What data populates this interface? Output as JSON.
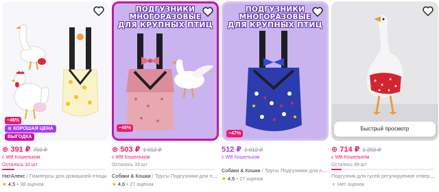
{
  "colors": {
    "accent": "#cb11ab",
    "price": "#f01b6b",
    "promo": "#a73afd",
    "star": "#ff9d00"
  },
  "icons": {
    "favorite": "heart-outline-icon",
    "rating": "star-icon"
  },
  "products": [
    {
      "price": "391 ₽",
      "old_price": "750 ₽",
      "wallet": "с WB Кошельком",
      "stock": "Осталось 10 шт",
      "stock_fraction": 0.12,
      "brand": "НатАлекс",
      "name": " / Памперсы для домашней птицы",
      "rating": "4,5",
      "reviews": "38 оценок",
      "discount": "−46%",
      "good_price": "ХОРОШАЯ ЦЕНА",
      "benefit": "ВЫГОДКА"
    },
    {
      "price": "503 ₽",
      "old_price": "1 012 ₽",
      "wallet": "с WB Кошельком",
      "stock": "Осталось 33 шт",
      "stock_fraction": 0.0,
      "brand": "Собаки & Кошки",
      "name": " / Трусы Подгузники для птиц",
      "rating": "4,6",
      "reviews": "27 оценок",
      "discount": "−46%",
      "banner": [
        "ПОДГУЗНИКИ",
        "МНОГОРАЗОВЫЕ",
        "ДЛЯ КРУПНЫХ ПТИЦ"
      ]
    },
    {
      "price": "512 ₽",
      "old_price": "1 012 ₽",
      "wallet": "с WB Кошельком",
      "brand": "Собаки & Кошки",
      "name": " / Трусы Подгузники для птиц",
      "rating": "4,6",
      "reviews": "27 оценок",
      "discount": "−47%",
      "banner": [
        "ПОДГУЗНИКИ",
        "МНОГОРАЗОВЫЕ",
        "ДЛЯ КРУПНЫХ ПТИЦ"
      ]
    },
    {
      "price": "714 ₽",
      "old_price": "1 250 ₽",
      "wallet": "с WB Кошельком",
      "stock": "Осталось 99 шт",
      "stock_fraction": 0.1,
      "brand": "",
      "name": "Подгузник для гусей регулируемое отверстие",
      "rating": "",
      "reviews": "Нет оценок",
      "quick_view": "Быстрый просмотр"
    }
  ]
}
